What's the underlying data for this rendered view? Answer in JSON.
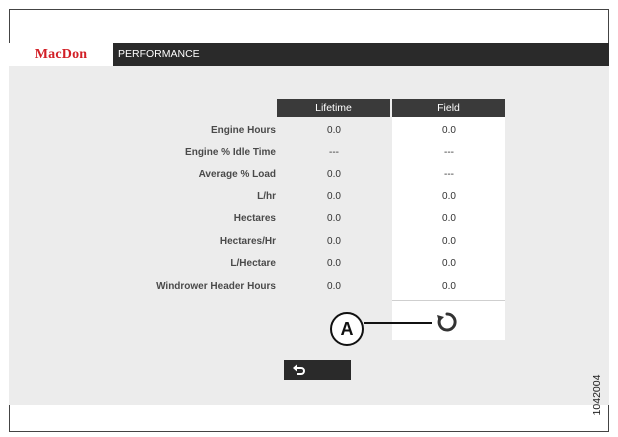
{
  "header": {
    "logo": "MacDon",
    "title": "PERFORMANCE"
  },
  "table": {
    "columns": [
      "Lifetime",
      "Field"
    ],
    "rows": [
      {
        "label": "Engine Hours",
        "lifetime": "0.0",
        "field": "0.0"
      },
      {
        "label": "Engine % Idle Time",
        "lifetime": "---",
        "field": "---"
      },
      {
        "label": "Average % Load",
        "lifetime": "0.0",
        "field": "---"
      },
      {
        "label": "L/hr",
        "lifetime": "0.0",
        "field": "0.0"
      },
      {
        "label": "Hectares",
        "lifetime": "0.0",
        "field": "0.0"
      },
      {
        "label": "Hectares/Hr",
        "lifetime": "0.0",
        "field": "0.0"
      },
      {
        "label": "L/Hectare",
        "lifetime": "0.0",
        "field": "0.0"
      },
      {
        "label": "Windrower Header Hours",
        "lifetime": "0.0",
        "field": "0.0"
      }
    ]
  },
  "callout": {
    "label": "A"
  },
  "figure_number": "1042004",
  "icons": {
    "reset": "reset-icon",
    "back": "back-arrow-icon"
  },
  "colors": {
    "brand_red": "#d21f26",
    "header_bg": "#2a2a2a",
    "screen_bg": "#ececec"
  }
}
